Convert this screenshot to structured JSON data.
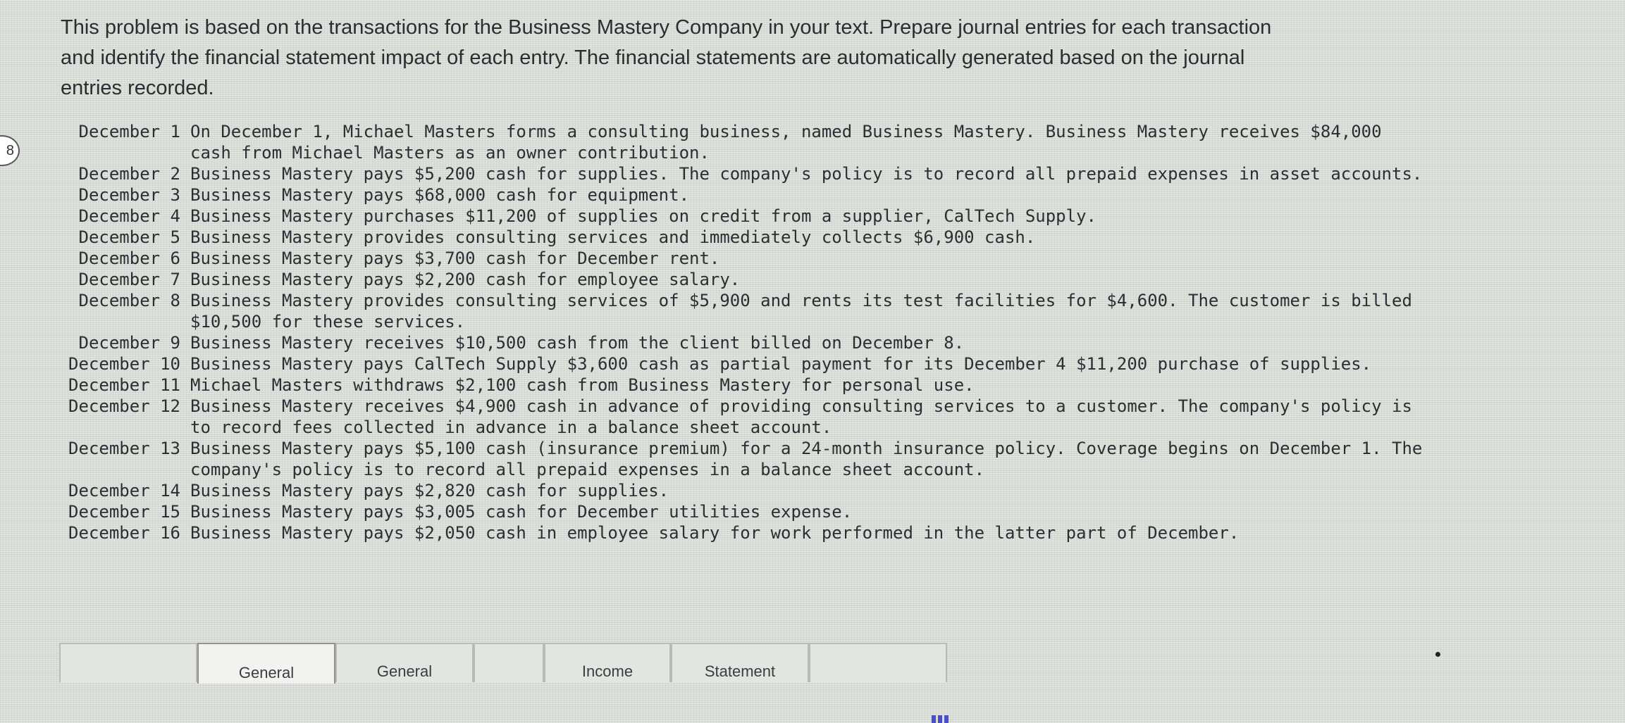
{
  "question_number": "8",
  "intro": [
    "This problem is based on the transactions for the Business Mastery Company in your text. Prepare journal entries for each transaction",
    "and identify the financial statement impact of each entry. The financial statements are automatically generated based on the journal",
    "entries recorded."
  ],
  "transactions": [
    {
      "date": "December 1",
      "text": "On December 1, Michael Masters forms a consulting business, named Business Mastery. Business Mastery receives $84,000 cash from Michael Masters as an owner contribution."
    },
    {
      "date": "December 2",
      "text": "Business Mastery pays $5,200 cash for supplies. The company's policy is to record all prepaid expenses in asset accounts."
    },
    {
      "date": "December 3",
      "text": "Business Mastery pays $68,000 cash for equipment."
    },
    {
      "date": "December 4",
      "text": "Business Mastery purchases $11,200 of supplies on credit from a supplier, CalTech Supply."
    },
    {
      "date": "December 5",
      "text": "Business Mastery provides consulting services and immediately collects $6,900 cash."
    },
    {
      "date": "December 6",
      "text": "Business Mastery pays $3,700 cash for December rent."
    },
    {
      "date": "December 7",
      "text": "Business Mastery pays $2,200 cash for employee salary."
    },
    {
      "date": "December 8",
      "text": "Business Mastery provides consulting services of $5,900 and rents its test facilities for $4,600. The customer is billed $10,500 for these services."
    },
    {
      "date": "December 9",
      "text": "Business Mastery receives $10,500 cash from the client billed on December 8."
    },
    {
      "date": "December 10",
      "text": "Business Mastery pays CalTech Supply $3,600 cash as partial payment for its December 4 $11,200 purchase of supplies."
    },
    {
      "date": "December 11",
      "text": "Michael Masters withdraws $2,100 cash from Business Mastery for personal use."
    },
    {
      "date": "December 12",
      "text": "Business Mastery receives $4,900 cash in advance of providing consulting services to a customer. The company's policy is to record fees collected in advance in a balance sheet account."
    },
    {
      "date": "December 13",
      "text": "Business Mastery pays $5,100 cash (insurance premium) for a 24-month insurance policy. Coverage begins on December 1. The company's policy is to record all prepaid expenses in a balance sheet account."
    },
    {
      "date": "December 14",
      "text": "Business Mastery pays $2,820 cash for supplies."
    },
    {
      "date": "December 15",
      "text": "Business Mastery pays $3,005 cash for December utilities expense."
    },
    {
      "date": "December 16",
      "text": "Business Mastery pays $2,050 cash in employee salary for work performed in the latter part of December."
    }
  ],
  "tabs": [
    {
      "label": ""
    },
    {
      "label": "General"
    },
    {
      "label": "General"
    },
    {
      "label": ""
    },
    {
      "label": "Income"
    },
    {
      "label": "Statement"
    },
    {
      "label": ""
    }
  ],
  "colors": {
    "background": "#d8dbd5",
    "text": "#2b2e33",
    "indicator": "#4a4fc7"
  }
}
